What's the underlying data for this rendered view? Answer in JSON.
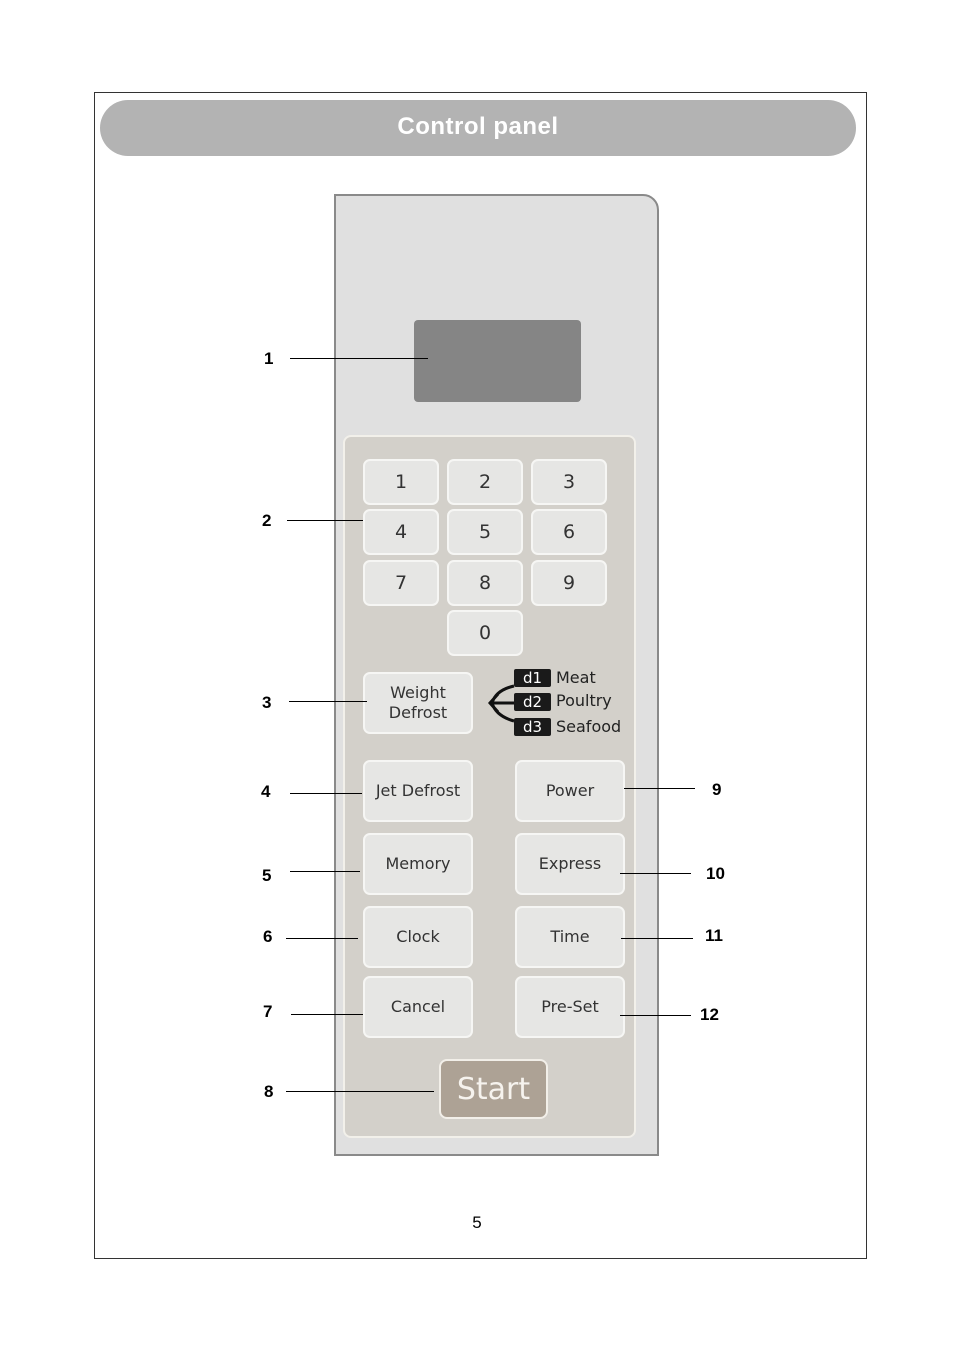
{
  "header": {
    "title": "Control panel"
  },
  "keypad": {
    "digits": [
      "1",
      "2",
      "3",
      "4",
      "5",
      "6",
      "7",
      "8",
      "9",
      "0"
    ]
  },
  "weight_defrost": {
    "label_line1": "Weight",
    "label_line2": "Defrost",
    "options": [
      {
        "code": "d1",
        "label": "Meat"
      },
      {
        "code": "d2",
        "label": "Poultry"
      },
      {
        "code": "d3",
        "label": "Seafood"
      }
    ]
  },
  "buttons": {
    "jet_defrost": "Jet Defrost",
    "memory": "Memory",
    "clock": "Clock",
    "cancel": "Cancel",
    "power": "Power",
    "express": "Express",
    "time": "Time",
    "preset": "Pre-Set",
    "start": "Start"
  },
  "callouts": [
    "1",
    "2",
    "3",
    "4",
    "5",
    "6",
    "7",
    "8",
    "9",
    "10",
    "11",
    "12"
  ],
  "page_number": "5"
}
